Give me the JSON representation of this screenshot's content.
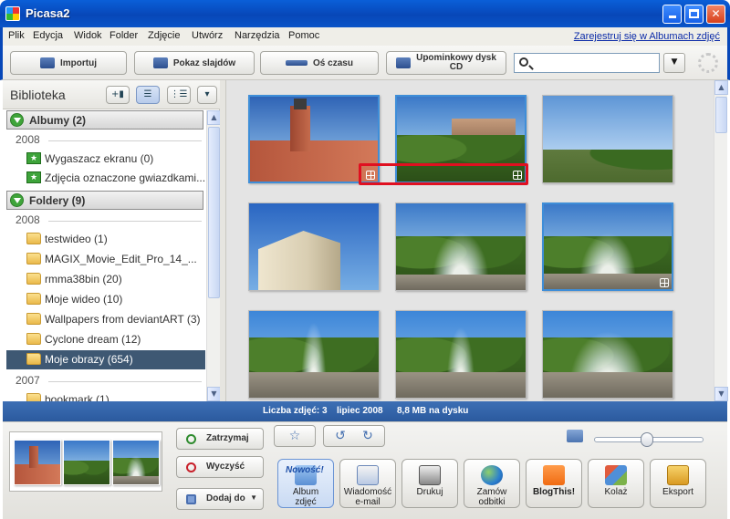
{
  "window": {
    "title": "Picasa2"
  },
  "menu": {
    "items": [
      "Plik",
      "Edycja",
      "Widok",
      "Folder",
      "Zdjęcie",
      "Utwórz",
      "Narzędzia",
      "Pomoc"
    ],
    "register_link": "Zarejestruj się w Albumach zdjęć"
  },
  "toolbar": {
    "import": "Importuj",
    "slideshow": "Pokaz slajdów",
    "timeline": "Oś czasu",
    "gift_cd_line1": "Upominkowy dysk",
    "gift_cd_line2": "CD",
    "search_placeholder": ""
  },
  "library": {
    "title": "Biblioteka",
    "albums": {
      "header": "Albumy (2)",
      "year": "2008",
      "items": [
        "Wygaszacz ekranu (0)",
        "Zdjęcia oznaczone gwiazdkami..."
      ]
    },
    "folders": {
      "header": "Foldery (9)",
      "year": "2008",
      "items": [
        "testwideo (1)",
        "MAGIX_Movie_Edit_Pro_14_...",
        "rmma38bin (20)",
        "Moje wideo (10)",
        "Wallpapers from deviantART (3)",
        "Cyclone dream (12)",
        "Moje obrazy (654)"
      ],
      "selected": "Moje obrazy (654)",
      "year2": "2007",
      "items2": [
        "bookmark (1)"
      ]
    }
  },
  "status": {
    "count": "Liczba zdjęć: 3",
    "date": "lipiec 2008",
    "size": "8,8 MB na dysku"
  },
  "tray": {
    "hold": "Zatrzymaj",
    "clear": "Wyczyść",
    "add_to": "Dodaj do",
    "actions": [
      {
        "label": "Album\nzdjęć",
        "badge": "Nowość!"
      },
      {
        "label": "Wiadomość\ne-mail"
      },
      {
        "label": "Drukuj"
      },
      {
        "label": "Zamów\nodbitki"
      },
      {
        "label": "BlogThis!"
      },
      {
        "label": "Kolaż"
      },
      {
        "label": "Eksport"
      }
    ]
  },
  "colors": {
    "titlebar": "#0747b8",
    "selection": "#3e5873",
    "status_bar": "#2b5a9e",
    "highlight_box": "#e01020",
    "photo_select_border": "#3f8ed8"
  }
}
